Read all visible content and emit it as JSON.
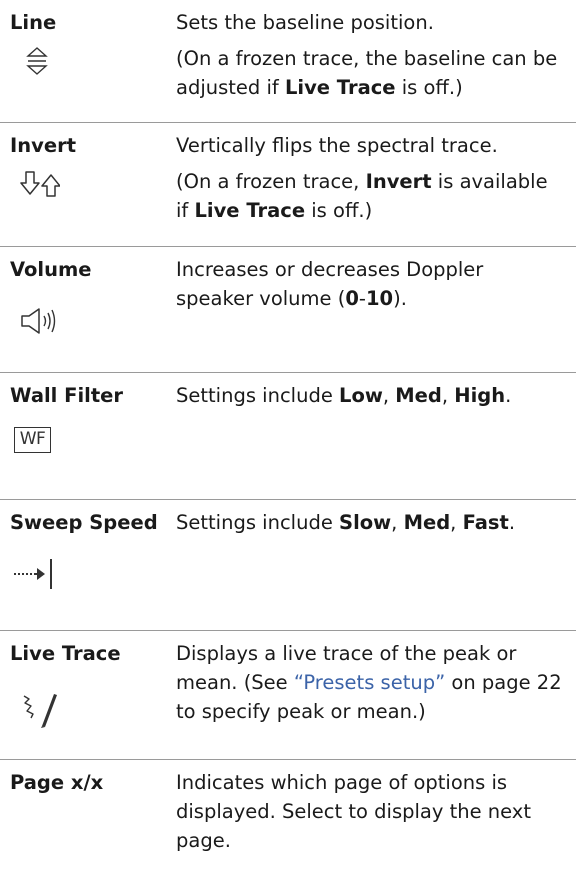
{
  "rows": [
    {
      "term": "Line",
      "icon": "baseline-position-icon",
      "desc1": "Sets the baseline position.",
      "desc2": {
        "a": "(On a frozen trace, the baseline can be adjusted if ",
        "b": "Live Trace",
        "c": " is off.)"
      }
    },
    {
      "term": "Invert",
      "icon": "invert-arrows-icon",
      "desc1": "Vertically flips the spectral trace.",
      "desc2": {
        "a": "(On a frozen trace, ",
        "b": "Invert",
        "c": " is available if ",
        "d": "Live Trace",
        "e": " is off.)"
      }
    },
    {
      "term": "Volume",
      "icon": "speaker-volume-icon",
      "desc1": {
        "a": "Increases or decreases Doppler speaker volume (",
        "b": "0",
        "c": "-",
        "d": "10",
        "e": ")."
      }
    },
    {
      "term": "Wall Filter",
      "icon": "wall-filter-icon",
      "icon_text": "WF",
      "desc1": {
        "a": "Settings include ",
        "b": "Low",
        "c": ", ",
        "d": "Med",
        "e": ", ",
        "f": "High",
        "g": "."
      }
    },
    {
      "term": "Sweep Speed",
      "icon": "sweep-speed-icon",
      "desc1": {
        "a": "Settings include ",
        "b": "Slow",
        "c": ", ",
        "d": "Med",
        "e": ", ",
        "f": "Fast",
        "g": "."
      }
    },
    {
      "term": "Live Trace",
      "icon": "live-trace-pen-icon",
      "desc1": {
        "a": "Displays a live trace of the peak or mean. (See ",
        "link": "“Presets setup”",
        "c": " on page 22 to specify peak or mean.)"
      }
    },
    {
      "term": "Page x/x",
      "desc1": "Indicates which page of options is displayed. Select to display the next page."
    }
  ],
  "colors": {
    "text": "#1a1a1a",
    "link": "#3b63a8",
    "divider": "#9a9a9a",
    "icon": "#333333"
  }
}
